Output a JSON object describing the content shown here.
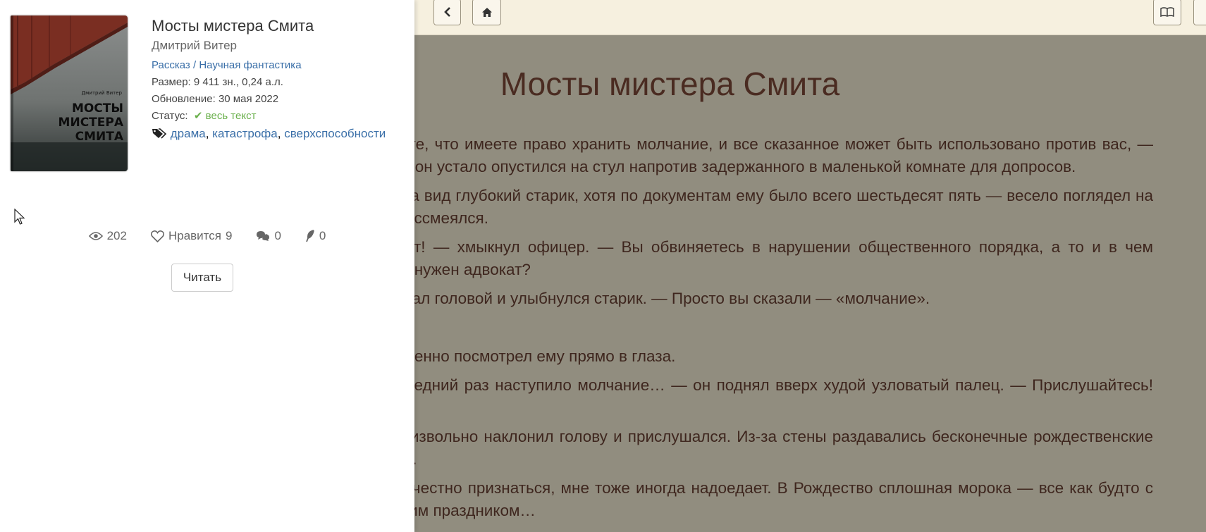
{
  "reader": {
    "title": "Мосты мистера Смита",
    "paragraphs": [
      "— Вы понимаете, что имеете право хранить молчание, и все сказанное может быть использовано против вас, — сержант Робинсон устало опустился на стул напротив задержанного в маленькой комнате для допросов.",
      "Мистер Смит, на вид глубокий старик, хотя по документам ему было всего шестьдесят пять — весело поглядел на офицера. Он рассмеялся.",
      "— Мистер Смит! — хмыкнул офицер. — Вы обвиняетесь в нарушении общественного порядка, а то и в чем похуже. Вам не нужен адвокат?",
      "— Нет, — покачал головой и улыбнулся старик. — Просто вы сказали — «молчание».",
      "",
      "Робинсон удивленно посмотрел ему прямо в глаза.",
      "— Когда в последний раз наступило молчание… — он поднял вверх худой узловатый палец. — Прислушайтесь! Вы слышите?",
      "Сержант непроизвольно наклонил голову и прислушался. Из-за стены раздавались бесконечные рождественские гимны по радио.",
      "— Да уж, если честно признаться, мне тоже иногда надоедает. В Рождество сплошная морока — все как будто с ума сходят с этим праздником…"
    ]
  },
  "card": {
    "cover": {
      "author": "Дмитрий Витер",
      "title_lines": [
        "МОСТЫ",
        "МИСТЕРА",
        "СМИТА"
      ]
    },
    "title": "Мосты мистера Смита",
    "author": "Дмитрий Витер",
    "genre_type": "Рассказ",
    "genre_sep": " / ",
    "genre": "Научная фантастика",
    "size_label": "Размер:",
    "size_value": "9 411 зн., 0,24 а.л.",
    "updated_label": "Обновление:",
    "updated_value": "30 мая 2022",
    "status_label": "Статус:",
    "status_value": "весь текст",
    "tags": [
      "драма",
      "катастрофа",
      "сверхспособности"
    ],
    "stats": {
      "views": "202",
      "likes_label": "Нравится",
      "likes": "9",
      "comments": "0",
      "rewards": "0"
    },
    "read_button": "Читать"
  },
  "icons": [
    "chevron-left-icon",
    "home-icon",
    "book-icon",
    "eye-icon",
    "heart-icon",
    "comments-icon",
    "feather-icon",
    "check-icon",
    "tags-icon",
    "cursor-icon"
  ]
}
